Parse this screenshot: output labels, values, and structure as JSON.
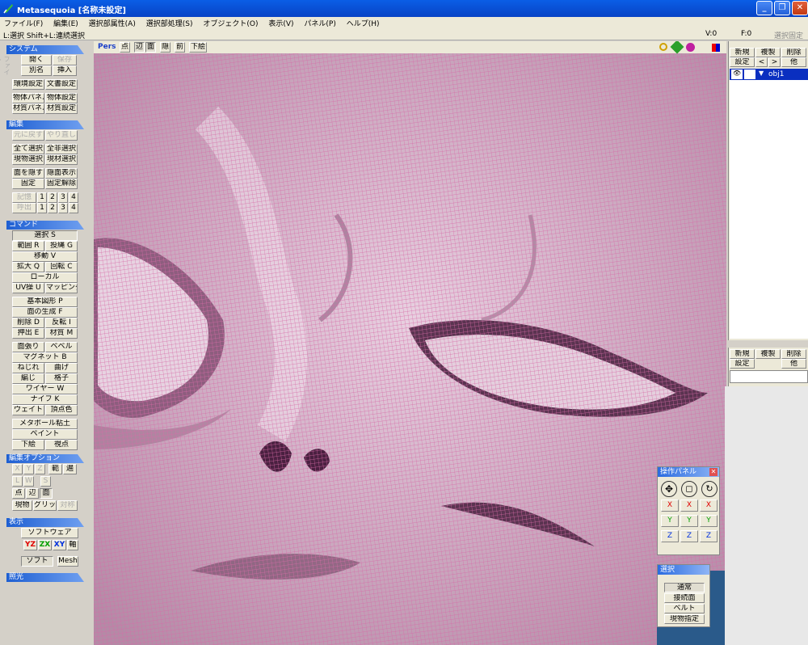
{
  "window": {
    "title": "Metasequoia [名称未設定]"
  },
  "menu": [
    "ファイル(F)",
    "編集(E)",
    "選択部属性(A)",
    "選択部処理(S)",
    "オブジェクト(O)",
    "表示(V)",
    "パネル(P)",
    "ヘルプ(H)"
  ],
  "status": {
    "hint": "L:選択 Shift+L:連続選択",
    "v": "V:0",
    "f": "F:0",
    "fix": "選択固定"
  },
  "sections": {
    "system": "システム",
    "edit": "編集",
    "command": "コマンド",
    "editopt": "編集オプション",
    "display": "表示",
    "light": "照光"
  },
  "system": {
    "open": "開く",
    "save": "保存",
    "saveas": "別名",
    "insert": "挿入",
    "env": "環境設定",
    "doc": "文書設定",
    "objpanel": "物体パネル",
    "objset": "物体設定",
    "matpanel": "材質パネル",
    "matset": "材質設定",
    "vlabel": "ファイル"
  },
  "edit": {
    "undo": "元に戻す",
    "redo": "やり直し",
    "selall": "全て選択",
    "desel": "全非選択",
    "selobj": "現物選択",
    "selmat": "現材選択",
    "hide": "面を隠す",
    "showhidden": "隠面表示",
    "fix": "固定",
    "unfix": "固定解除",
    "mem": "記憶",
    "recall": "呼出",
    "n1": "1",
    "n2": "2",
    "n3": "3",
    "n4": "4"
  },
  "command": {
    "select": "選択 S",
    "range": "範囲 R",
    "lasso": "投縄 G",
    "move": "移動 V",
    "scale": "拡大 Q",
    "rotate": "回転 C",
    "local": "ローカル",
    "uv": "UV操 U",
    "mapping": "マッピング",
    "basic": "基本図形 P",
    "faceGen": "面の生成 F",
    "del": "削除 D",
    "flip": "反転 I",
    "extrude": "押出 E",
    "material": "材質 M",
    "stretch": "面張り",
    "bevel": "ベベル",
    "magnet": "マグネット B",
    "twist": "ねじれ",
    "bend": "曲げ",
    "knife2": "編じ",
    "lattice": "格子",
    "wire": "ワイヤー W",
    "knife": "ナイフ K",
    "weight": "ウェイト",
    "vcolor": "頂点色",
    "metaball": "メタボール粘土",
    "paint": "ペイント",
    "underlay": "下絵",
    "viewpoint": "視点"
  },
  "editopt": {
    "x": "X",
    "y": "Y",
    "z": "Z",
    "range": "範",
    "around": "遍",
    "l": "L",
    "w": "W",
    "s": "S",
    "pt": "点",
    "edge": "辺",
    "face": "面",
    "curobj": "現物",
    "grid": "グリッド",
    "sym": "対称"
  },
  "display": {
    "software": "ソフトウェア",
    "yz": "YZ",
    "zx": "ZX",
    "xy": "XY",
    "axis": "軸",
    "soft": "ソフト",
    "mesh": "Mesh"
  },
  "viewtoolbar": {
    "pers": "Pers",
    "pt": "点",
    "edge": "辺",
    "face": "面",
    "back": "隠",
    "front": "前",
    "underlay": "下絵"
  },
  "objpanel": {
    "new": "新規",
    "dup": "複製",
    "del": "削除",
    "settings": "設定",
    "prev": "<",
    "next": ">",
    "other": "他",
    "obj": "obj1"
  },
  "matpanel": {
    "new": "新規",
    "dup": "複製",
    "del": "削除",
    "settings": "設定",
    "other": "他"
  },
  "opPanel": {
    "title": "操作パネル",
    "x": "X",
    "y": "Y",
    "z": "Z"
  },
  "selPanel": {
    "title": "選択",
    "normal": "通常",
    "connected": "接続面",
    "belt": "ベルト",
    "curobj": "現物指定"
  },
  "colors": {
    "axisX": "#e00000",
    "axisY": "#00a000",
    "axisZ": "#0030e0",
    "mesh": "#d86aa8",
    "title": "#0843c5"
  }
}
